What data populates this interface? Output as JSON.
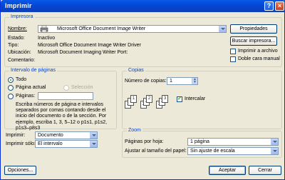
{
  "window": {
    "title": "Imprimir",
    "help": "?",
    "close": "×"
  },
  "printer": {
    "group_title": "Impresora",
    "name_label": "Nombre:",
    "name_value": "Microsoft Office Document Image Writer",
    "properties_button": "Propiedades",
    "find_printer_button": "Buscar impresora...",
    "status_label": "Estado:",
    "status_value": "Inactivo",
    "type_label": "Tipo:",
    "type_value": "Microsoft Office Document Image Writer Driver",
    "location_label": "Ubicación:",
    "location_value": "Microsoft Document Imaging Writer Port:",
    "comment_label": "Comentario:",
    "print_to_file_label": "Imprimir a archivo",
    "manual_duplex_label": "Doble cara manual"
  },
  "page_range": {
    "group_title": "Intervalo de páginas",
    "all_label": "Todo",
    "current_page_label": "Página actual",
    "selection_label": "Selección",
    "pages_label": "Páginas:",
    "pages_value": "",
    "help_text": "Escriba números de página e intervalos separados por comas contando desde el inicio del documento o de la sección. Por ejemplo, escriba 1, 3, 5–12 o p1s1, p1s2, p1s3–p8s3"
  },
  "copies": {
    "group_title": "Copias",
    "count_label": "Número de copias:",
    "count_value": "1",
    "collate_label": "Intercalar",
    "collate_checked": true
  },
  "print_what": {
    "print_label": "Imprimir:",
    "print_value": "Documento",
    "print_only_label": "Imprimir sólo:",
    "print_only_value": "El intervalo"
  },
  "zoom": {
    "group_title": "Zoom",
    "pages_per_sheet_label": "Páginas por hoja:",
    "pages_per_sheet_value": "1 página",
    "scale_label": "Ajustar al tamaño del papel:",
    "scale_value": "Sin ajuste de escala"
  },
  "footer": {
    "options_button": "Opciones...",
    "ok_button": "Aceptar",
    "cancel_button": "Cerrar"
  },
  "colors": {
    "title_bar": "#0348d4",
    "group_label": "#0046d5",
    "dialog_bg": "#ece9d8"
  }
}
